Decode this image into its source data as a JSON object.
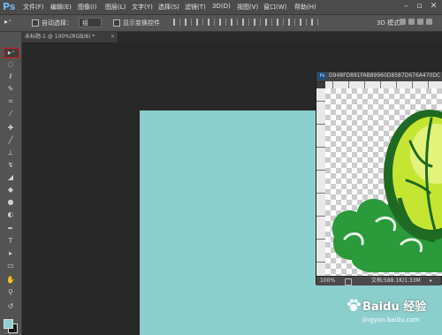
{
  "app": {
    "logo": "Ps"
  },
  "menu": {
    "items": [
      "文件(F)",
      "编辑(E)",
      "图像(I)",
      "图层(L)",
      "文字(Y)",
      "选择(S)",
      "滤镜(T)",
      "3D(D)",
      "视图(V)",
      "窗口(W)",
      "帮助(H)"
    ]
  },
  "window_controls": {
    "minimize": "–",
    "restore": "▫",
    "close": "✕"
  },
  "options_bar": {
    "tool_glyph": "▸⁺",
    "auto_select_label": "自动选择：",
    "auto_select_value": "组",
    "show_transform_label": "显示变换控件",
    "mode_label": "3D 模式："
  },
  "doc_tab": {
    "label": "未标题-1 @ 100%(RGB/8) *",
    "close": "×"
  },
  "floating_window": {
    "icon_label": "Ps",
    "title": "D948FD891FAB89960D8587D676A470DC"
  },
  "status": {
    "zoom": "100%",
    "doc_info": "文档:588.1K/1.33M",
    "arrow": "▸"
  },
  "watermark": {
    "brand": "Baidu 经验",
    "url": "jingyan.baidu.com"
  },
  "toolbox": {
    "tools": [
      {
        "name": "move-tool",
        "glyph": "▸⁺"
      },
      {
        "name": "marquee-tool",
        "glyph": "◌"
      },
      {
        "name": "lasso-tool",
        "glyph": "ℓ"
      },
      {
        "name": "quick-select-tool",
        "glyph": "✎"
      },
      {
        "name": "crop-tool",
        "glyph": "⌗"
      },
      {
        "name": "eyedropper-tool",
        "glyph": "⁄"
      },
      {
        "name": "healing-tool",
        "glyph": "✚"
      },
      {
        "name": "brush-tool",
        "glyph": "╱"
      },
      {
        "name": "clone-stamp-tool",
        "glyph": "⊥"
      },
      {
        "name": "history-brush-tool",
        "glyph": "↯"
      },
      {
        "name": "eraser-tool",
        "glyph": "◢"
      },
      {
        "name": "paint-bucket-tool",
        "glyph": "◆"
      },
      {
        "name": "blur-tool",
        "glyph": "●"
      },
      {
        "name": "dodge-tool",
        "glyph": "◐"
      },
      {
        "name": "pen-tool",
        "glyph": "✒"
      },
      {
        "name": "type-tool",
        "glyph": "T"
      },
      {
        "name": "path-select-tool",
        "glyph": "▸"
      },
      {
        "name": "shape-tool",
        "glyph": "▭"
      },
      {
        "name": "hand-tool",
        "glyph": "✋"
      },
      {
        "name": "zoom-tool",
        "glyph": "⚲"
      },
      {
        "name": "swap-colors",
        "glyph": "↺"
      }
    ]
  },
  "colors": {
    "canvas": "#8bcfcd",
    "foreground": "#8dd0d0",
    "background": "#111111",
    "active_tool_outline": "#e4171d",
    "leaf_light": "#c4e633",
    "leaf_dark": "#1f7a2a",
    "cloud": "#2a9a3a"
  }
}
